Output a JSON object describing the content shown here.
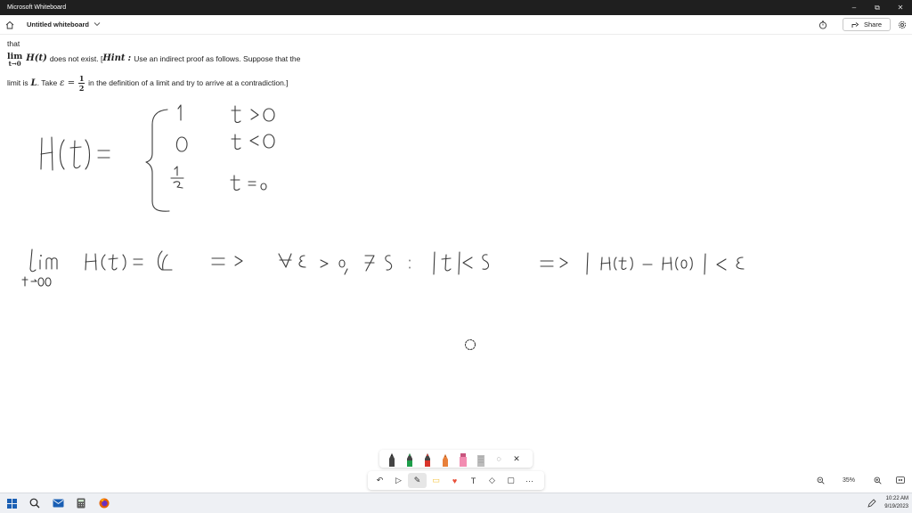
{
  "window": {
    "title": "Microsoft Whiteboard",
    "controls": {
      "minimize": "–",
      "restore": "⧉",
      "close": "✕"
    }
  },
  "header": {
    "board_title": "Untitled whiteboard",
    "share_label": "Share",
    "icons": [
      "home-icon",
      "chevron-down-icon",
      "timer-icon",
      "share-icon",
      "settings-icon"
    ]
  },
  "problem": {
    "line1": "that",
    "lim": "lim",
    "lim_sub": "t→0",
    "func": "H(t)",
    "line2_text": "does not exist. [",
    "hint": "Hint",
    "hint_colon": ":",
    "line2_rest": "Use an indirect proof as follows. Suppose that the",
    "line3_a": "limit is",
    "L": "L",
    "line3_b": ". Take",
    "epsilon_eq": "ε =",
    "frac_num": "1",
    "frac_den": "2",
    "line3_c": "in the definition of a limit and try to arrive at a contradiction.]"
  },
  "pen_tray": {
    "pens": [
      {
        "name": "black-pen",
        "color": "#222222"
      },
      {
        "name": "green-pen",
        "color": "#1e9e4a"
      },
      {
        "name": "red-pen",
        "color": "#d9342b"
      },
      {
        "name": "orange-pen",
        "color": "#e8803a"
      },
      {
        "name": "pink-highlighter",
        "color": "#f28cb1"
      },
      {
        "name": "gray-eraser",
        "color": "#9a9a9a"
      }
    ],
    "tools": {
      "lasso": "◌",
      "close": "✕"
    }
  },
  "toolbar": {
    "undo": "↶",
    "select": "▷",
    "ink": "✎",
    "note": "▭",
    "reaction": "♥",
    "text": "T",
    "shapes": "◇",
    "templates": "▢",
    "more": "···"
  },
  "zoom": {
    "zoom_out": "−",
    "level": "35%",
    "zoom_in": "+",
    "fit": "⤢"
  },
  "taskbar": {
    "icons": [
      "windows-icon",
      "search-icon",
      "mail-icon",
      "calculator-icon",
      "firefox-icon"
    ],
    "time": "10:22 AM",
    "date": "9/19/2023"
  },
  "colors": {
    "titlebar": "#1f1f1f",
    "ink": "#3b3b3b",
    "taskbar": "#eef0f4",
    "heart": "#e8503a",
    "note": "#f5c33b"
  }
}
